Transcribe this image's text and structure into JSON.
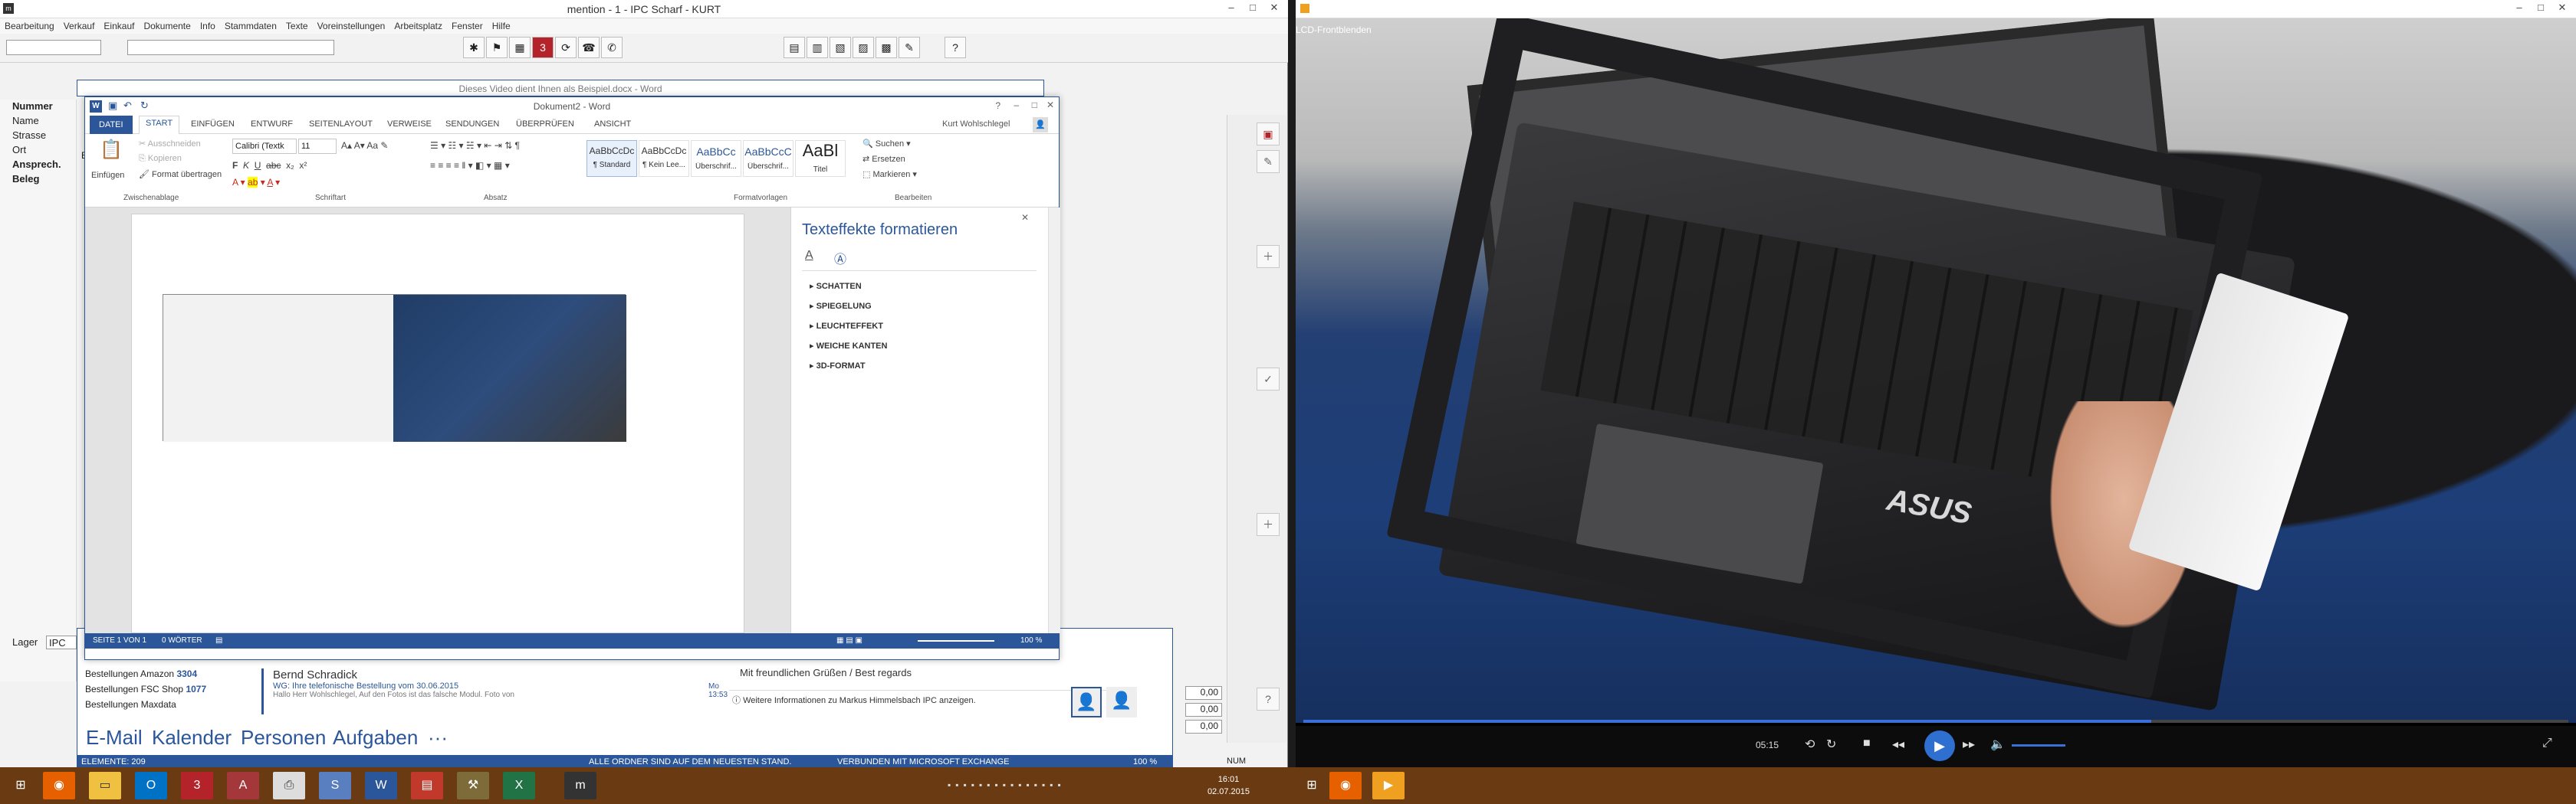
{
  "erp": {
    "title": "mention - 1 - IPC Scharf - KURT",
    "menu": [
      "Bearbeitung",
      "Verkauf",
      "Einkauf",
      "Dokumente",
      "Info",
      "Stammdaten",
      "Texte",
      "Voreinstellungen",
      "Arbeitsplatz",
      "Fenster",
      "Hilfe"
    ],
    "fields": [
      "Nummer",
      "Name",
      "Strasse",
      "Ort",
      "Ansprech.",
      "Beleg"
    ],
    "bottom_label": "Lager",
    "bottom_value": "IPC",
    "values": [
      "0,00",
      "0,00",
      "0,00"
    ],
    "ein_label": "Ein",
    "num_label": "NUM"
  },
  "outlook": {
    "folders": [
      {
        "name": "Bestellungen Amazon",
        "count": "3304"
      },
      {
        "name": "Bestellungen FSC Shop",
        "count": "1077"
      },
      {
        "name": "Bestellungen Maxdata",
        "count": ""
      }
    ],
    "mail": {
      "sender": "Bernd Schradick",
      "subject": "WG: Ihre telefonische Bestellung vom 30.06.2015",
      "preview": "Hallo Herr Wohlschlegel,  Auf den Fotos ist das falsche Modul. Foto von",
      "time": "Mo 13:53"
    },
    "reading_greeting": "Mit freundlichen Grüßen / Best regards",
    "info_line": "Weitere Informationen zu Markus Himmelsbach IPC anzeigen.",
    "nav": [
      "E-Mail",
      "Kalender",
      "Personen",
      "Aufgaben",
      "···"
    ],
    "status": {
      "elements": "ELEMENTE: 209",
      "sync": "ALLE ORDNER SIND AUF DEM NEUESTEN STAND.",
      "connection": "VERBUNDEN MIT MICROSOFT EXCHANGE",
      "zoom": "100 %"
    }
  },
  "word_back": {
    "title": "Dieses Video dient Ihnen als Beispiel.docx - Word"
  },
  "word": {
    "title": "Dokument2 - Word",
    "user": "Kurt Wohlschlegel",
    "tabs": [
      "DATEI",
      "START",
      "EINFÜGEN",
      "ENTWURF",
      "SEITENLAYOUT",
      "VERWEISE",
      "SENDUNGEN",
      "ÜBERPRÜFEN",
      "ANSICHT"
    ],
    "clipboard": {
      "paste": "Einfügen",
      "cut": "Ausschneiden",
      "copy": "Kopieren",
      "format": "Format übertragen",
      "label": "Zwischenablage"
    },
    "font": {
      "name": "Calibri (Textk",
      "size": "11",
      "label": "Schriftart"
    },
    "paragraph_label": "Absatz",
    "styles": [
      {
        "preview": "AaBbCcDc",
        "name": "¶ Standard"
      },
      {
        "preview": "AaBbCcDc",
        "name": "¶ Kein Lee..."
      },
      {
        "preview": "AaBbCc",
        "name": "Überschrif..."
      },
      {
        "preview": "AaBbCcC",
        "name": "Überschrif..."
      },
      {
        "preview": "AaBl",
        "name": "Titel"
      }
    ],
    "styles_label": "Formatvorlagen",
    "editing": {
      "find": "Suchen",
      "replace": "Ersetzen",
      "select": "Markieren",
      "label": "Bearbeiten"
    },
    "pane": {
      "title": "Texteffekte formatieren",
      "items": [
        "SCHATTEN",
        "SPIEGELUNG",
        "LEUCHTEFFEKT",
        "WEICHE KANTEN",
        "3D-FORMAT"
      ]
    },
    "status": {
      "page": "SEITE 1 VON 1",
      "words": "0 WÖRTER",
      "zoom": "100 %"
    }
  },
  "video": {
    "subtitle": "LCD-Frontblenden",
    "time": "05:15",
    "progress_fraction": 0.67,
    "brand": "ASUS"
  },
  "taskbar": {
    "clock_time": "16:01",
    "clock_date": "02.07.2015",
    "apps": [
      "firefox-icon",
      "explorer-icon",
      "outlook-icon",
      "app-3-icon",
      "access-icon",
      "printer-icon",
      "sf-icon",
      "word-icon",
      "pdf-icon",
      "tool-icon",
      "excel-icon",
      "mention-icon"
    ]
  },
  "colors": {
    "word_blue": "#2b579a",
    "taskbar": "#6a3b12",
    "video_accent": "#2f6fd0"
  }
}
